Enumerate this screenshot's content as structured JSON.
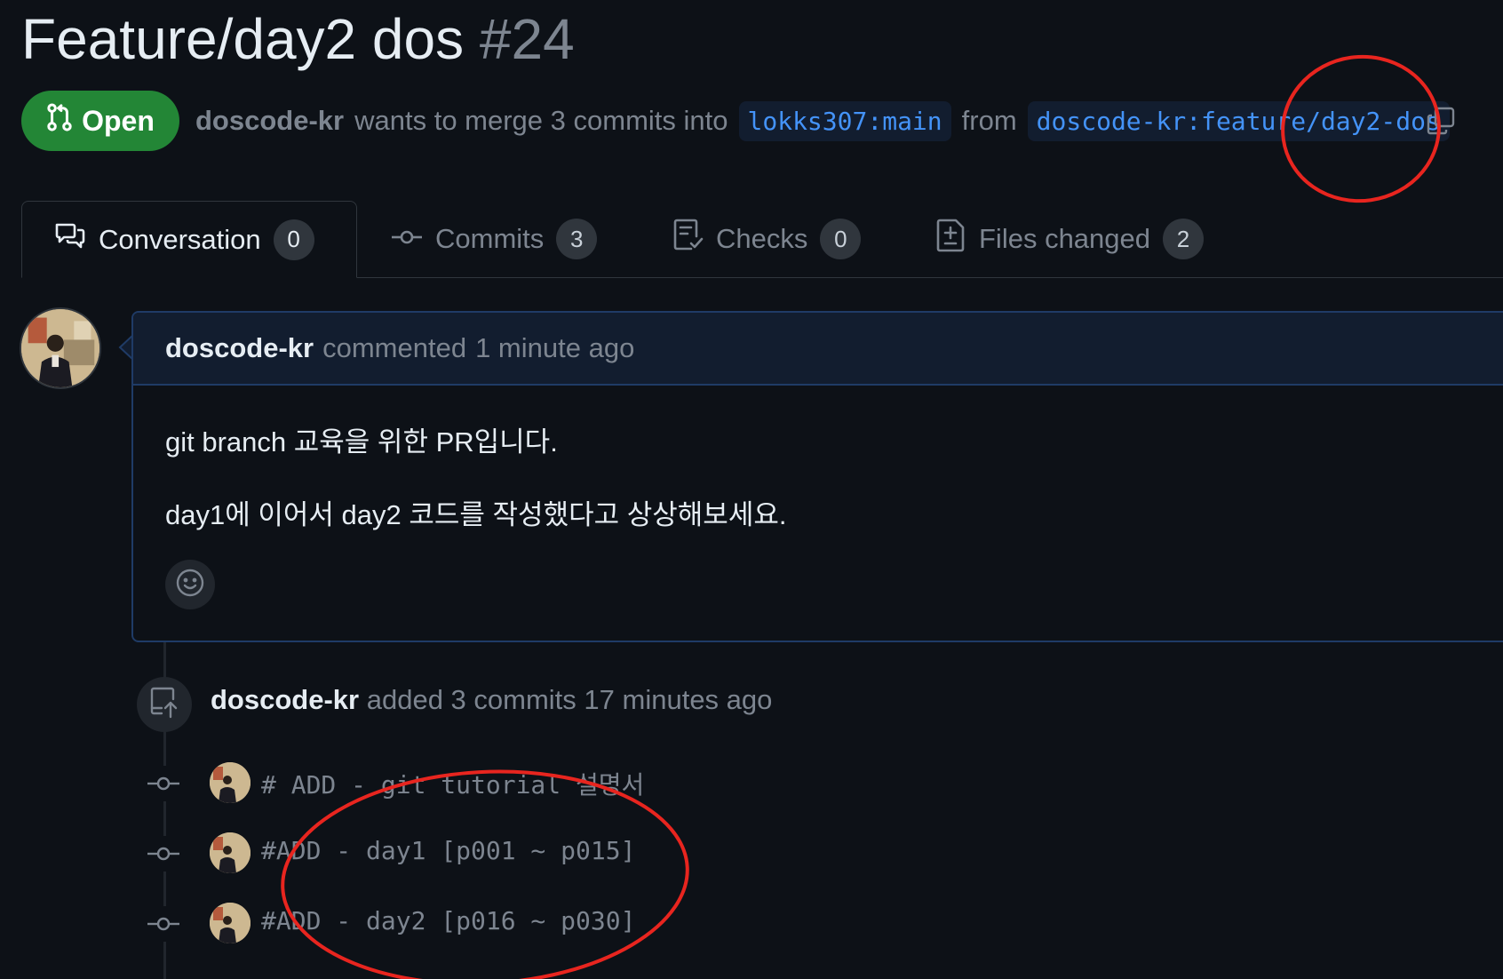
{
  "pr": {
    "title": "Feature/day2 dos",
    "number": "#24",
    "status": "Open",
    "author": "doscode-kr",
    "merge_text_mid": "wants to merge 3 commits into",
    "base_branch": "lokks307:main",
    "from_text": "from",
    "head_branch": "doscode-kr:feature/day2-dos"
  },
  "tabs": [
    {
      "label": "Conversation",
      "count": "0",
      "icon": "conversation-icon"
    },
    {
      "label": "Commits",
      "count": "3",
      "icon": "commit-icon"
    },
    {
      "label": "Checks",
      "count": "0",
      "icon": "checklist-icon"
    },
    {
      "label": "Files changed",
      "count": "2",
      "icon": "file-diff-icon"
    }
  ],
  "comment": {
    "author": "doscode-kr",
    "action": "commented",
    "time": "1 minute ago",
    "body_line1": "git branch 교육을 위한 PR입니다.",
    "body_line2": "day1에 이어서 day2 코드를 작성했다고 상상해보세요."
  },
  "timeline": {
    "push_event": {
      "author": "doscode-kr",
      "text": "added 3 commits",
      "time": "17 minutes ago"
    },
    "commits": [
      {
        "message": "# ADD - git tutorial 설명서"
      },
      {
        "message": "#ADD - day1 [p001 ~ p015]"
      },
      {
        "message": "#ADD - day2 [p016 ~ p030]"
      }
    ]
  },
  "colors": {
    "background": "#0d1117",
    "open_badge": "#238636",
    "branch_text": "#4493f8",
    "annotation": "#e8251f"
  }
}
